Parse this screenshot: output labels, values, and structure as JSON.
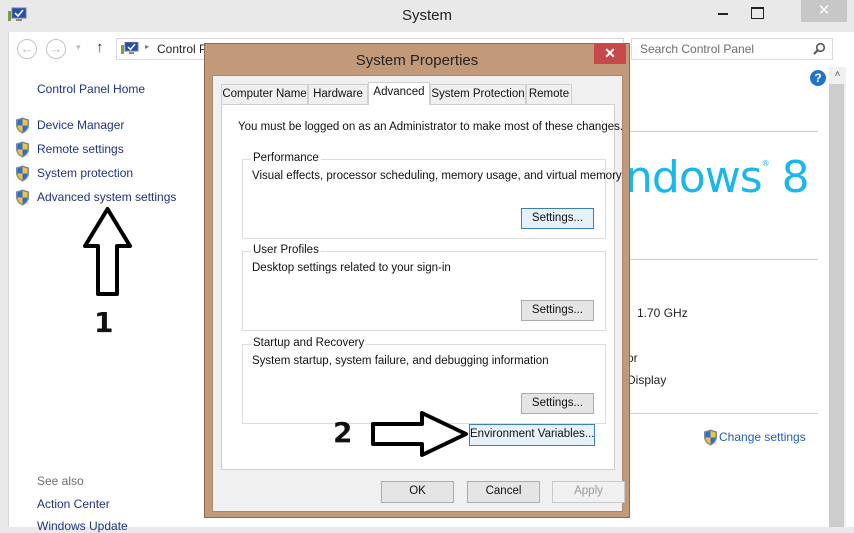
{
  "window": {
    "title": "System",
    "close_glyph": "✕"
  },
  "nav": {
    "back_glyph": "←",
    "forward_glyph": "→",
    "recent_glyph": "▾",
    "up_glyph": "↑",
    "address_separator": "▸",
    "address_text": "Control P",
    "search_placeholder": "Search Control Panel"
  },
  "sidebar": {
    "home": "Control Panel Home",
    "items": [
      {
        "label": "Device Manager",
        "icon": "uac-shield-icon"
      },
      {
        "label": "Remote settings",
        "icon": "uac-shield-icon"
      },
      {
        "label": "System protection",
        "icon": "uac-shield-icon"
      },
      {
        "label": "Advanced system settings",
        "icon": "uac-shield-icon"
      }
    ],
    "see_also": "See also",
    "see_also_links": [
      "Action Center",
      "Windows Update"
    ]
  },
  "system_panel": {
    "help_glyph": "?",
    "logo_text": "ndows",
    "logo_mark": "®",
    "logo_version": " 8",
    "cpu_speed": "1.70 GHz",
    "system_type_fragment": "or",
    "pen_touch_fragment": "Display",
    "change_settings": "Change settings",
    "scroll_up_glyph": "˄"
  },
  "dialog": {
    "title": "System Properties",
    "close_glyph": "✕",
    "tabs": [
      {
        "label": "Computer Name",
        "active": false
      },
      {
        "label": "Hardware",
        "active": false
      },
      {
        "label": "Advanced",
        "active": true
      },
      {
        "label": "System Protection",
        "active": false
      },
      {
        "label": "Remote",
        "active": false
      }
    ],
    "admin_note": "You must be logged on as an Administrator to make most of these changes.",
    "groups": [
      {
        "title": "Performance",
        "description": "Visual effects, processor scheduling, memory usage, and virtual memory",
        "button": "Settings..."
      },
      {
        "title": "User Profiles",
        "description": "Desktop settings related to your sign-in",
        "button": "Settings..."
      },
      {
        "title": "Startup and Recovery",
        "description": "System startup, system failure, and debugging information",
        "button": "Settings..."
      }
    ],
    "env_button": "Environment Variables...",
    "ok": "OK",
    "cancel": "Cancel",
    "apply": "Apply"
  },
  "annotations": {
    "step1": "1",
    "step2": "2"
  },
  "colors": {
    "link": "#1e3287",
    "dialog_frame": "#c29a7a",
    "dialog_close": "#c7484b",
    "win8_logo": "#1ab7ea",
    "help": "#1f74c9"
  }
}
